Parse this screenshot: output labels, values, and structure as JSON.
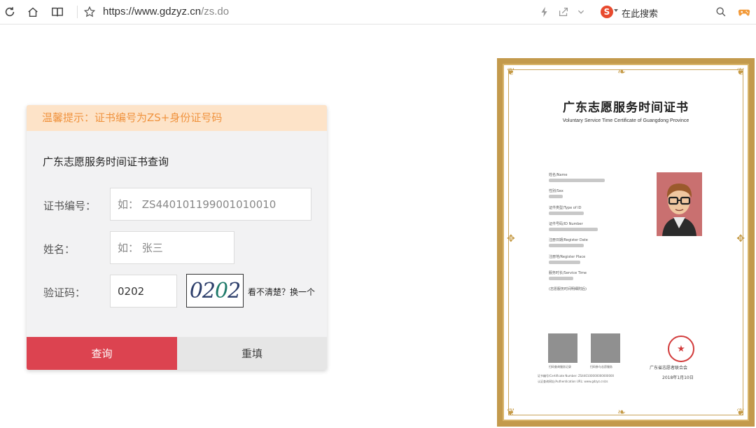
{
  "browser": {
    "url_host": "https://www.gdzyz.cn",
    "url_path": "/zs.do",
    "search_placeholder": "在此搜索"
  },
  "form": {
    "tip": "温馨提示：证书编号为ZS+身份证号码",
    "title": "广东志愿服务时间证书查询",
    "cert_no_label": "证书编号：",
    "cert_no_placeholder": "如： ZS440101199001010010",
    "name_label": "姓名：",
    "name_placeholder": "如： 张三",
    "captcha_label": "验证码：",
    "captcha_value": "0202",
    "captcha_image_text": [
      "0",
      "2",
      "0",
      "2"
    ],
    "refresh_text": "看不清楚？换一个",
    "query_button": "查询",
    "reset_button": "重填",
    "colors": {
      "query": "#dc4350",
      "tip_bg": "#fde3c8",
      "tip_text": "#f0933f"
    }
  },
  "certificate": {
    "title": "广东志愿服务时间证书",
    "subtitle": "Voluntary Service Time Certificate of Guangdong Province",
    "fields": [
      "姓名/Name",
      "性别/Sex",
      "证件类型/Type of ID",
      "证件号码/ID Number",
      "注册日期/Register Date",
      "注册地/Register Place",
      "服务时长/Service Time"
    ],
    "note": "(志愿服务时间明细附后)",
    "qr_labels": [
      "扫码查询服务记录",
      "扫码参与志愿服务"
    ],
    "org": "广东省志愿者联合会",
    "date": "2018年1月10日",
    "cert_number_line": "证书编号/Certificate Number: ZS440100000000000000",
    "auth_line": "认证查询网址/Authentication URL: www.gdzyz.cn/zs"
  }
}
